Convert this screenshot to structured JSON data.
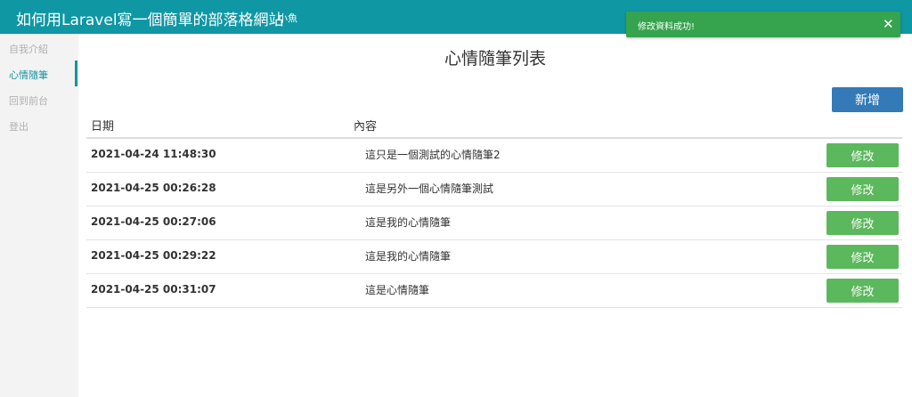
{
  "header": {
    "title": "如何用Laravel寫一個簡單的部落格網站",
    "user": "小魚"
  },
  "sidebar": {
    "items": [
      {
        "label": "自我介紹",
        "active": false
      },
      {
        "label": "心情隨筆",
        "active": true
      },
      {
        "label": "回到前台",
        "active": false
      },
      {
        "label": "登出",
        "active": false
      }
    ]
  },
  "main": {
    "title": "心情隨筆列表",
    "add_label": "新增",
    "columns": {
      "date": "日期",
      "content": "內容"
    },
    "edit_label": "修改",
    "rows": [
      {
        "date": "2021-04-24 11:48:30",
        "content": "這只是一個測試的心情隨筆2"
      },
      {
        "date": "2021-04-25 00:26:28",
        "content": "這是另外一個心情隨筆測試"
      },
      {
        "date": "2021-04-25 00:27:06",
        "content": "這是我的心情隨筆"
      },
      {
        "date": "2021-04-25 00:29:22",
        "content": "這是我的心情隨筆"
      },
      {
        "date": "2021-04-25 00:31:07",
        "content": "這是心情隨筆"
      }
    ]
  },
  "toast": {
    "message": "修改資料成功!",
    "close_icon": "✕"
  },
  "colors": {
    "topbar": "#0f97a4",
    "primary": "#337ab7",
    "success": "#5cb85c",
    "toast": "#36a34e"
  }
}
